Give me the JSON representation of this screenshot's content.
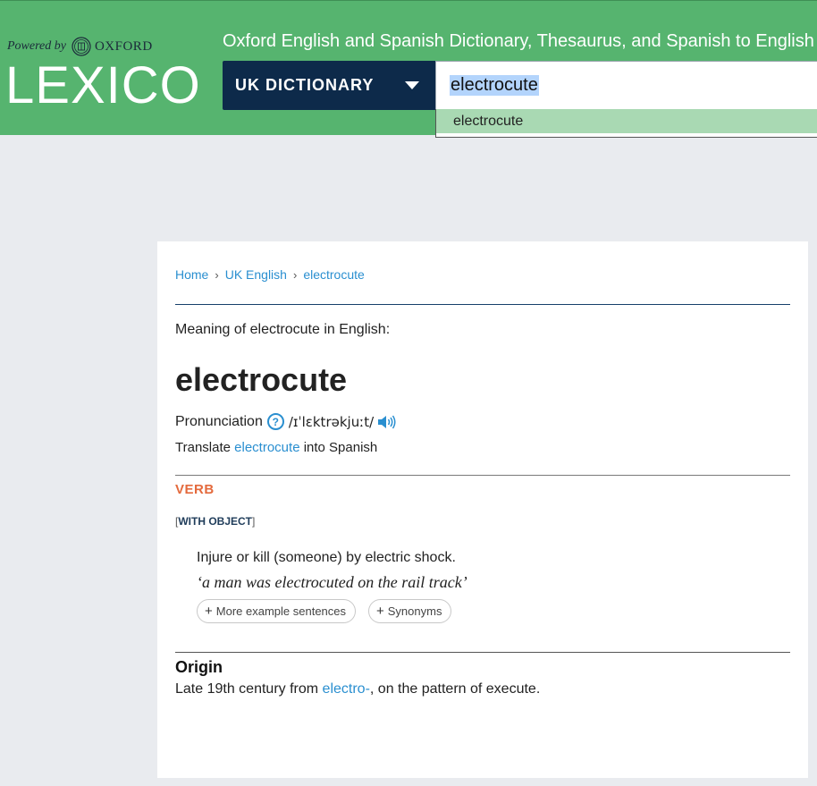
{
  "header": {
    "powered_by": "Powered by",
    "oxford": "OXFORD",
    "logo": "LEXICO",
    "tagline": "Oxford English and Spanish Dictionary, Thesaurus, and Spanish to English",
    "dictionary_select": "UK DICTIONARY",
    "search_value": "electrocute",
    "suggestion": "electrocute",
    "colors": {
      "header_bg": "#56b46f",
      "select_bg": "#0d2a4a",
      "suggestion_bg": "#a9d9b3"
    }
  },
  "breadcrumb": {
    "home": "Home",
    "sep1": "›",
    "section": "UK English",
    "sep2": "›",
    "current": "electrocute"
  },
  "entry": {
    "meaning_line": "Meaning of electrocute in English:",
    "headword": "electrocute",
    "pronunciation_label": "Pronunciation",
    "help_icon_text": "?",
    "ipa": "/ɪˈlɛktrəkjuːt/",
    "translate_pre": "Translate",
    "translate_link": "electrocute",
    "translate_post": "into Spanish",
    "part_of_speech": "VERB",
    "gram_open": "[",
    "grammar_note": "WITH OBJECT",
    "gram_close": "]",
    "definition": "Injure or kill (someone) by electric shock.",
    "example": "‘a man was electrocuted on the rail track’",
    "more_examples_button": "More example sentences",
    "synonyms_button": "Synonyms",
    "plus": "+",
    "origin_heading": "Origin",
    "origin_pre": "Late 19th century from",
    "origin_link": "electro-",
    "origin_post": ", on the pattern of execute."
  }
}
